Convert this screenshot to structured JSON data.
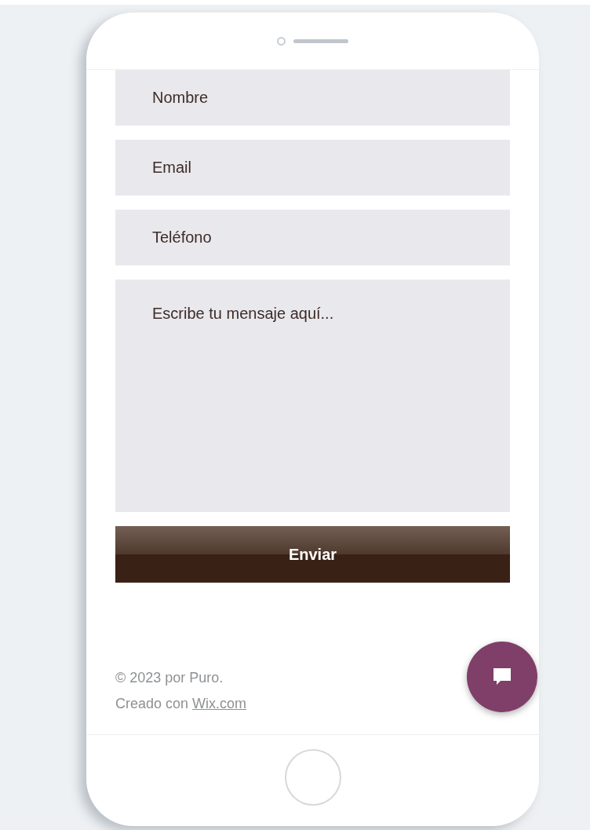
{
  "form": {
    "fields": [
      {
        "placeholder": "Nombre",
        "kind": "input"
      },
      {
        "placeholder": "Email",
        "kind": "input"
      },
      {
        "placeholder": "Teléfono",
        "kind": "input"
      },
      {
        "placeholder": "Escribe tu mensaje aquí...",
        "kind": "textarea"
      }
    ],
    "submit": "Enviar"
  },
  "footer": {
    "copyright": "© 2023 por Puro.",
    "credit": "Creado con",
    "link": "Wix.com"
  }
}
